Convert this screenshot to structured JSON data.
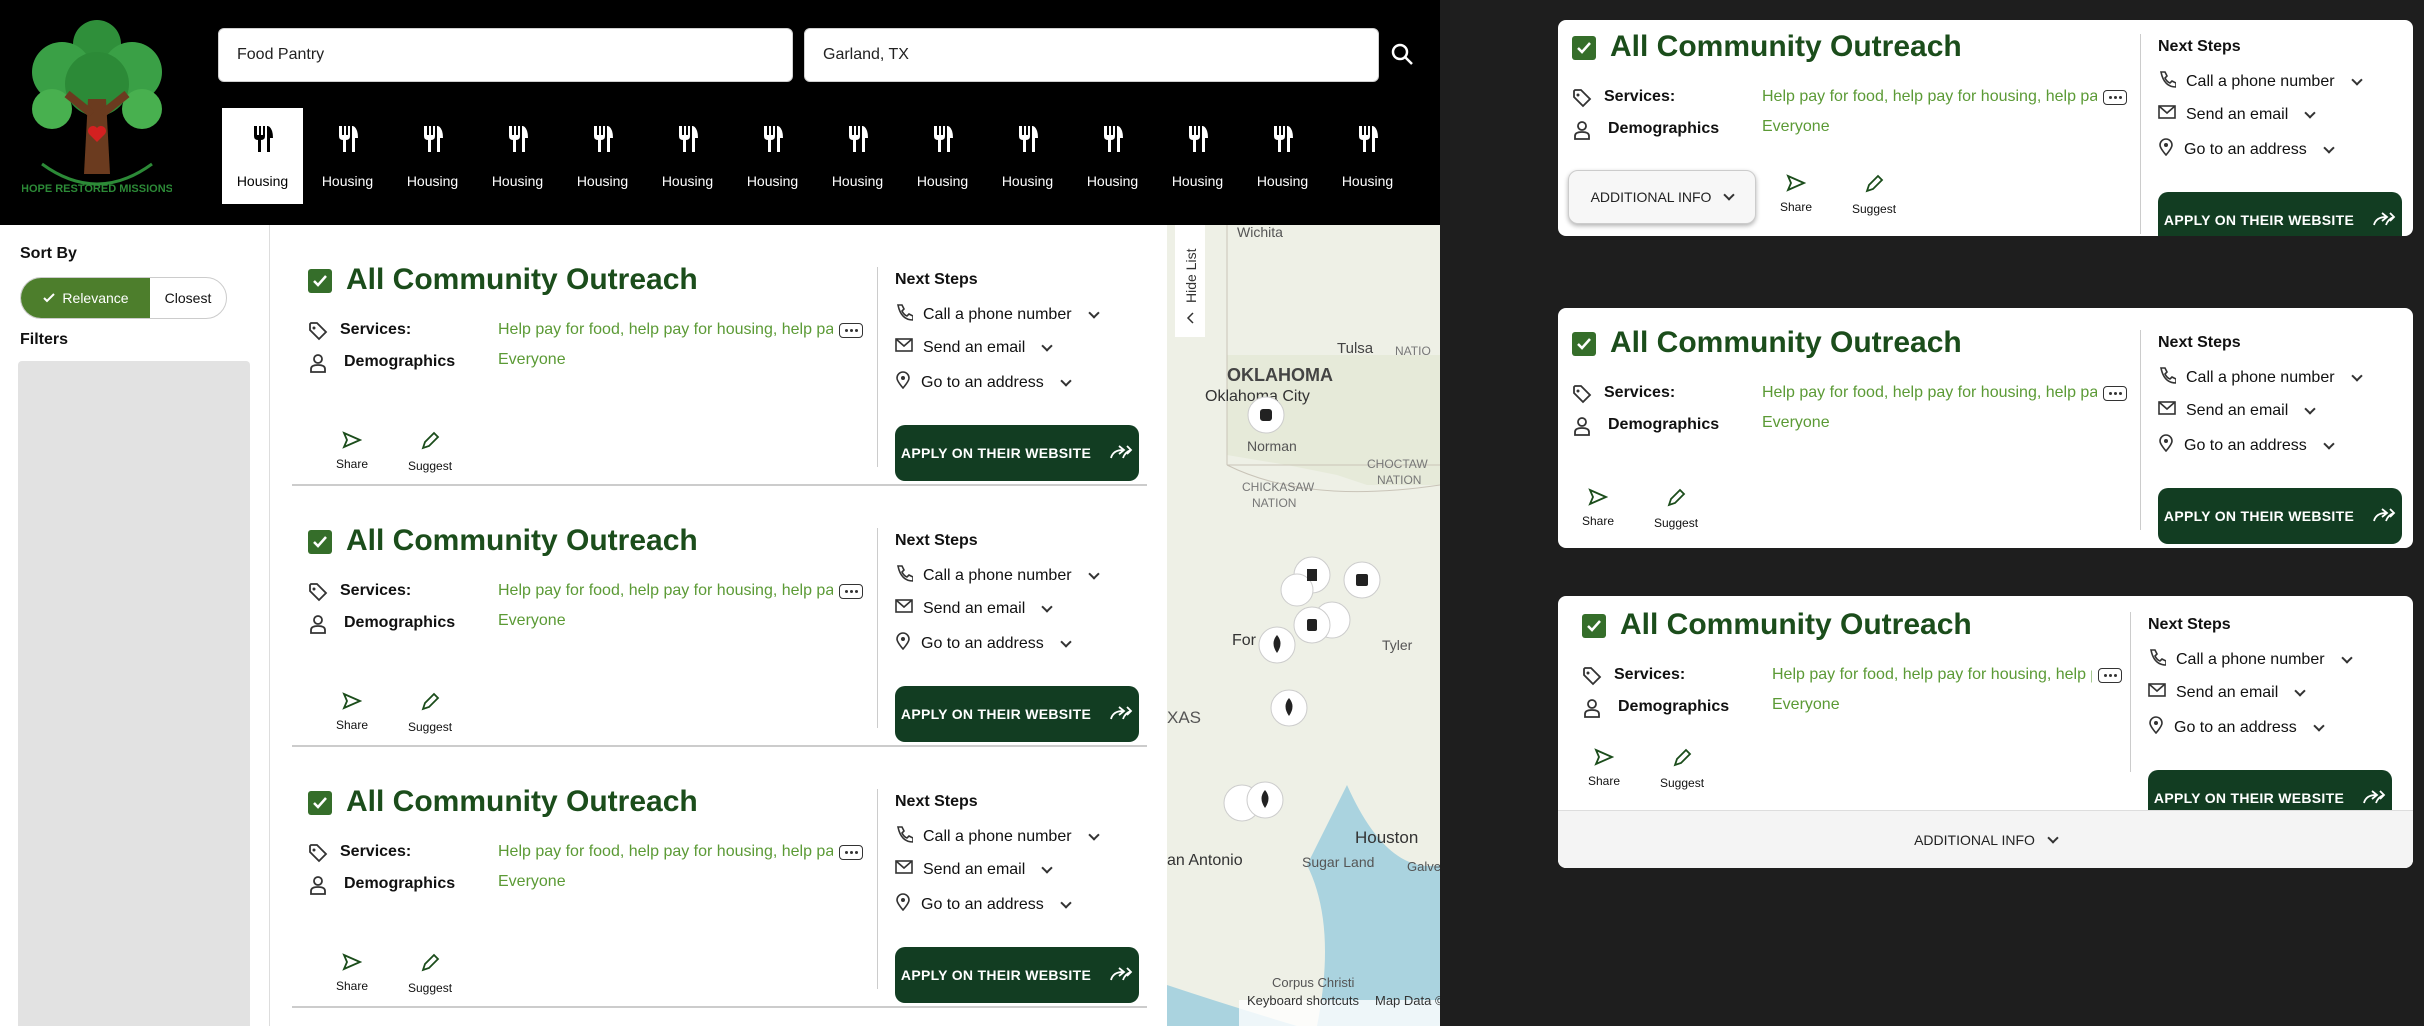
{
  "header": {
    "search_value": "Food Pantry",
    "location_value": "Garland, TX",
    "logo_text": "HOPE RESTORED MISSIONS",
    "categories": [
      "Housing",
      "Housing",
      "Housing",
      "Housing",
      "Housing",
      "Housing",
      "Housing",
      "Housing",
      "Housing",
      "Housing",
      "Housing",
      "Housing",
      "Housing",
      "Housing"
    ]
  },
  "sidebar": {
    "sort_label": "Sort By",
    "sort_relevance": "Relevance",
    "sort_closest": "Closest",
    "filters_label": "Filters"
  },
  "card": {
    "title": "All Community Outreach",
    "services_label": "Services:",
    "services_value": "Help pay for food, help pay for housing, help pay for utilities",
    "demographics_label": "Demographics",
    "demographics_value": "Everyone",
    "share_label": "Share",
    "suggest_label": "Suggest",
    "next_steps_label": "Next Steps",
    "call_label": "Call a phone number",
    "email_label": "Send an email",
    "address_label": "Go to an address",
    "apply_label": "APPLY ON THEIR WEBSITE",
    "additional_info_label": "ADDITIONAL INFO"
  },
  "map": {
    "hide_list_label": "Hide List",
    "keyboard_label": "Keyboard shortcuts",
    "map_data_label": "Map Data ©",
    "places": [
      "OKLAHOMA",
      "Oklahoma City",
      "Norman",
      "Tulsa",
      "CHICKASAW NATION",
      "CHOCTAW NATION",
      "Fort Worth",
      "Tyler",
      "TEXAS",
      "San Antonio",
      "Sugar Land",
      "Houston",
      "Galveston",
      "Corpus Christi",
      "Wichita"
    ]
  },
  "colors": {
    "brand_green": "#123d22",
    "accent_green": "#4d7e2c",
    "text_green": "#5b9a35"
  }
}
